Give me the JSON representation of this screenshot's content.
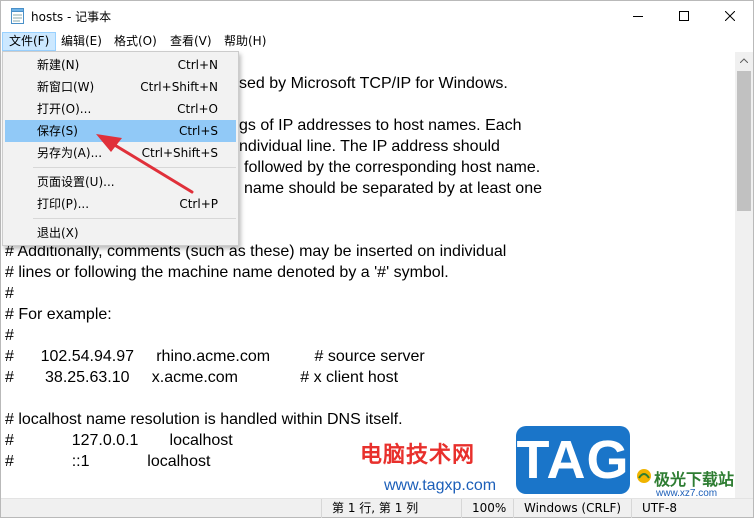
{
  "window": {
    "title": "hosts - 记事本"
  },
  "menubar": {
    "items": [
      "文件(F)",
      "编辑(E)",
      "格式(O)",
      "查看(V)",
      "帮助(H)"
    ]
  },
  "file_menu": {
    "items": [
      {
        "label": "新建(N)",
        "shortcut": "Ctrl+N"
      },
      {
        "label": "新窗口(W)",
        "shortcut": "Ctrl+Shift+N"
      },
      {
        "label": "打开(O)...",
        "shortcut": "Ctrl+O"
      },
      {
        "label": "保存(S)",
        "shortcut": "Ctrl+S"
      },
      {
        "label": "另存为(A)...",
        "shortcut": "Ctrl+Shift+S"
      },
      {
        "label": "页面设置(U)...",
        "shortcut": ""
      },
      {
        "label": "打印(P)...",
        "shortcut": "Ctrl+P"
      },
      {
        "label": "退出(X)",
        "shortcut": ""
      }
    ],
    "highlighted": "保存(S)"
  },
  "editor": {
    "lines": [
      "sed by Microsoft TCP/IP for Windows.",
      "gs of IP addresses to host names. Each",
      "ndividual line. The IP address should",
      "followed by the corresponding host name.",
      "name should be separated by at least one",
      "# Additionally, comments (such as these) may be inserted on individual",
      "# lines or following the machine name denoted by a '#' symbol.",
      "#",
      "# For example:",
      "#",
      "#      102.54.94.97     rhino.acme.com          # source server",
      "#       38.25.63.10     x.acme.com              # x client host",
      "# localhost name resolution is handled within DNS itself.",
      "#             127.0.0.1       localhost",
      "#             ::1             localhost"
    ]
  },
  "statusbar": {
    "position": "第 1 行, 第 1 列",
    "zoom": "100%",
    "line_ending": "Windows (CRLF)",
    "encoding": "UTF-8"
  },
  "watermark": {
    "site_name": "电脑技术网",
    "url": "www.tagxp.com",
    "tag": "TAG",
    "logo_cn": "极光下载站",
    "logo_en": "www.xz7.com"
  },
  "colors": {
    "menu_highlight": "#91c9f7",
    "menubar_active": "#cce8ff",
    "arrow": "#e0303a",
    "tag_blue": "#1a75c9",
    "watermark_red": "#e8302c"
  },
  "icons": {
    "app": "notepad-icon",
    "minimize": "minimize-icon",
    "maximize": "maximize-icon",
    "close": "close-icon"
  }
}
